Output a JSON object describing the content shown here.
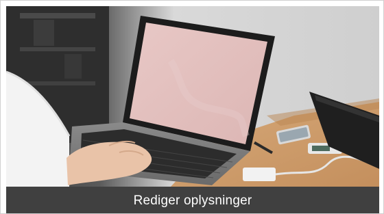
{
  "tile": {
    "image_subject": "laptop-photo",
    "caption": "Rediger oplysninger"
  },
  "colors": {
    "caption_bar": "#404040",
    "caption_text": "#ffffff",
    "screen": "#e3c0c0"
  }
}
